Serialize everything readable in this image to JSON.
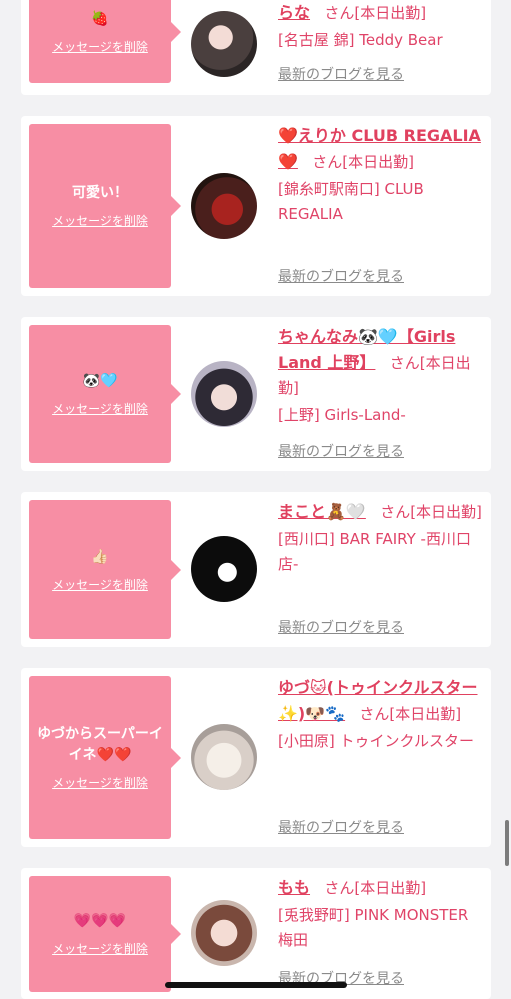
{
  "delete_label": "メッセージを削除",
  "blog_label": "最新のブログを見る",
  "san_label": "さん",
  "cards": [
    {
      "message": "🍓",
      "name": "らな",
      "status": "[本日出勤]",
      "shop": "[名古屋 錦] Teddy Bear"
    },
    {
      "message": "可愛い！",
      "name": "❤️えりか CLUB REGALIA❤️",
      "status": "[本日出勤]",
      "shop": "[錦糸町駅南口] CLUB REGALIA"
    },
    {
      "message": "🐼🩵",
      "name": "ちゃんなみ🐼🩵【Girls Land 上野】",
      "status": "[本日出勤]",
      "shop": "[上野] Girls-Land-"
    },
    {
      "message": "👍🏻",
      "name": "まこと🧸🤍",
      "status": "[本日出勤]",
      "shop": "[西川口] BAR FAIRY -西川口店-"
    },
    {
      "message": "ゆづからスーパーイイネ❤️❤️",
      "name": "ゆづ🐱(トゥインクルスター✨)🐶🐾",
      "status": "[本日出勤]",
      "shop": "[小田原] トゥインクルスター"
    },
    {
      "message": "💗💗💗",
      "name": "もも",
      "status": "[本日出勤]",
      "shop": "[兎我野町] PINK MONSTER梅田"
    }
  ],
  "colors": {
    "accent_pink": "#f78ea4",
    "name_red": "#e0415f",
    "text_pink": "#e04468",
    "link_gray": "#8a8a8a",
    "background": "#f2f2f4"
  }
}
